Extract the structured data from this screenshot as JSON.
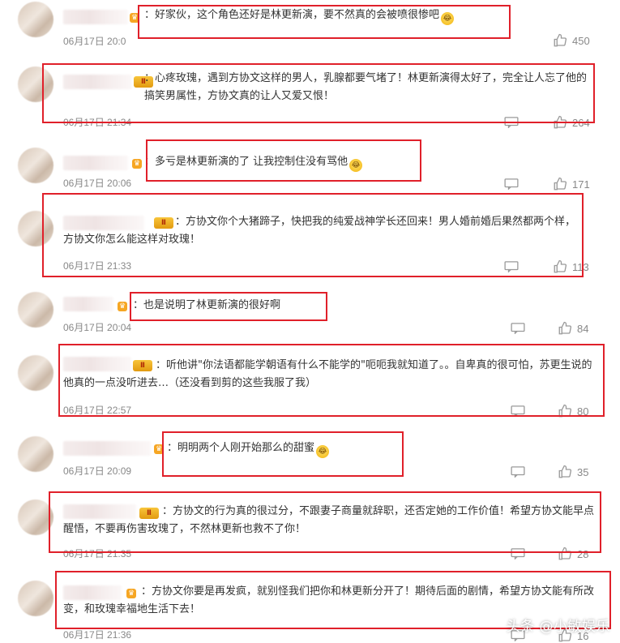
{
  "comments": [
    {
      "text": "好家伙，这个角色还好是林更新演，要不然真的会被喷很惨吧",
      "emoji": true,
      "time": "06月17日 20:0",
      "likes": "450",
      "badge": "crown"
    },
    {
      "text": "心疼玫瑰，遇到方协文这样的男人，乳腺都要气堵了！林更新演得太好了，完全让人忘了他的搞笑男属性，方协文真的让人又爱又恨！",
      "emoji": false,
      "time": "06月17日 21:34",
      "likes": "264",
      "badge": "vip"
    },
    {
      "text": "多亏是林更新演的了 让我控制住没有骂他",
      "emoji": true,
      "time": "06月17日 20:06",
      "likes": "171",
      "badge": "crown"
    },
    {
      "text": "方协文你个大猪蹄子，快把我的纯爱战神学长还回来！男人婚前婚后果然都两个样，方协文你怎么能这样对玫瑰！",
      "emoji": false,
      "time": "06月17日 21:33",
      "likes": "113",
      "badge": "vip"
    },
    {
      "text": "也是说明了林更新演的很好啊",
      "emoji": false,
      "time": "06月17日 20:04",
      "likes": "84",
      "badge": "crown"
    },
    {
      "text": "听他讲\"你法语都能学朝语有什么不能学的\"呃呃我就知道了。。自卑真的很可怕，苏更生说的他真的一点没听进去…（还没看到剪的这些我服了我）",
      "emoji": false,
      "time": "06月17日 22:57",
      "likes": "80",
      "badge": "vip"
    },
    {
      "text": "明明两个人刚开始那么的甜蜜",
      "emoji": true,
      "time": "06月17日 20:09",
      "likes": "35",
      "badge": "crown"
    },
    {
      "text": "方协文的行为真的很过分，不跟妻子商量就辞职，还否定她的工作价值！希望方协文能早点醒悟，不要再伤害玫瑰了，不然林更新也救不了你！",
      "emoji": false,
      "time": "06月17日 21:35",
      "likes": "28",
      "badge": "vip"
    },
    {
      "text": "方协文你要是再发疯，就别怪我们把你和林更新分开了！期待后面的剧情，希望方协文能有所改变，和玫瑰幸福地生活下去！",
      "emoji": false,
      "time": "06月17日 21:36",
      "likes": "16",
      "badge": "vip"
    }
  ],
  "badge_vip_label": "Ⅱ",
  "watermark": "头条 @小敏娱乐",
  "colors": {
    "highlight": "#e0202a",
    "text": "#333333",
    "meta": "#888888"
  }
}
